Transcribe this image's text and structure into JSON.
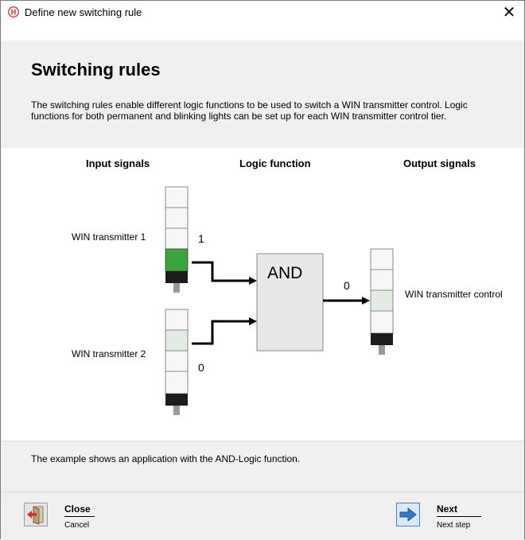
{
  "window": {
    "title": "Define new switching rule",
    "close_glyph": "✕"
  },
  "header": {
    "title": "Switching rules",
    "description": "The switching rules enable different logic functions to be used to switch a WIN transmitter control. Logic functions for both permanent and blinking lights can be set up for each WIN transmitter control tier."
  },
  "diagram": {
    "col_input": "Input signals",
    "col_logic": "Logic function",
    "col_output": "Output signals",
    "input1_label": "WIN transmitter 1",
    "input2_label": "WIN transmitter 2",
    "output_label": "WIN transmitter control",
    "gate_label": "AND",
    "value_in1": "1",
    "value_in2": "0",
    "value_out": "0",
    "colors": {
      "active_green": "#3aa53a",
      "inactive_green": "#e3ece3",
      "tier_white": "#f7f7f7"
    }
  },
  "footer": {
    "note": "The example shows an application with the AND-Logic function."
  },
  "buttons": {
    "close_label": "Close",
    "close_sub": "Cancel",
    "close_icon": "exit-door-icon",
    "next_label": "Next",
    "next_sub": "Next step",
    "next_icon": "arrow-right-icon"
  }
}
